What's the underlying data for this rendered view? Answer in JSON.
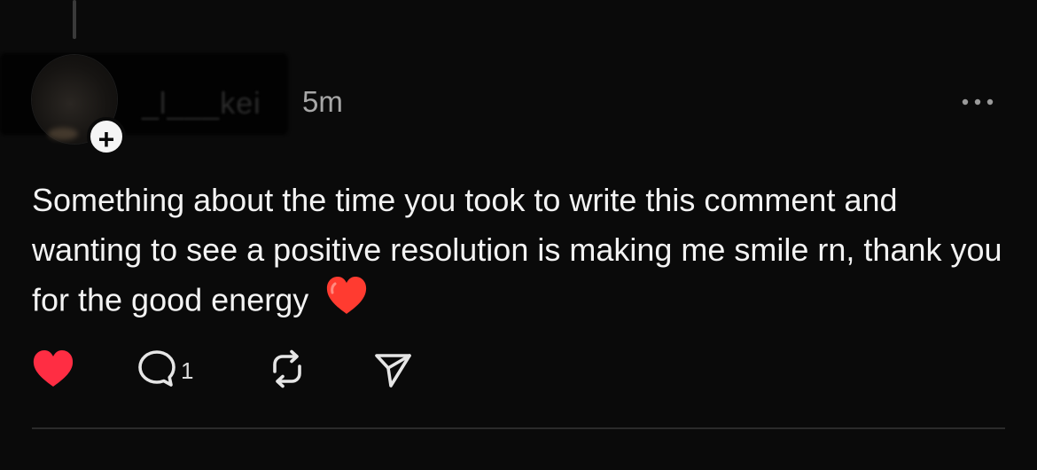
{
  "post": {
    "username": "_l___kei",
    "time_ago": "5m",
    "more_icon": "more-horizontal-icon",
    "text": "Something about the time you took to write this comment and wanting to see a positive resolution is making me smile rn, thank you for the good energy",
    "emoji": "red-heart-emoji",
    "actions": {
      "like_icon": "heart-filled-icon",
      "reply_icon": "comment-icon",
      "reply_count": "1",
      "repost_icon": "repost-icon",
      "share_icon": "send-icon"
    }
  },
  "colors": {
    "background": "#0a0a0a",
    "text": "#f3f3f3",
    "muted": "#a7a7a7",
    "like": "#ff2d43",
    "divider": "#2b2b2b"
  }
}
